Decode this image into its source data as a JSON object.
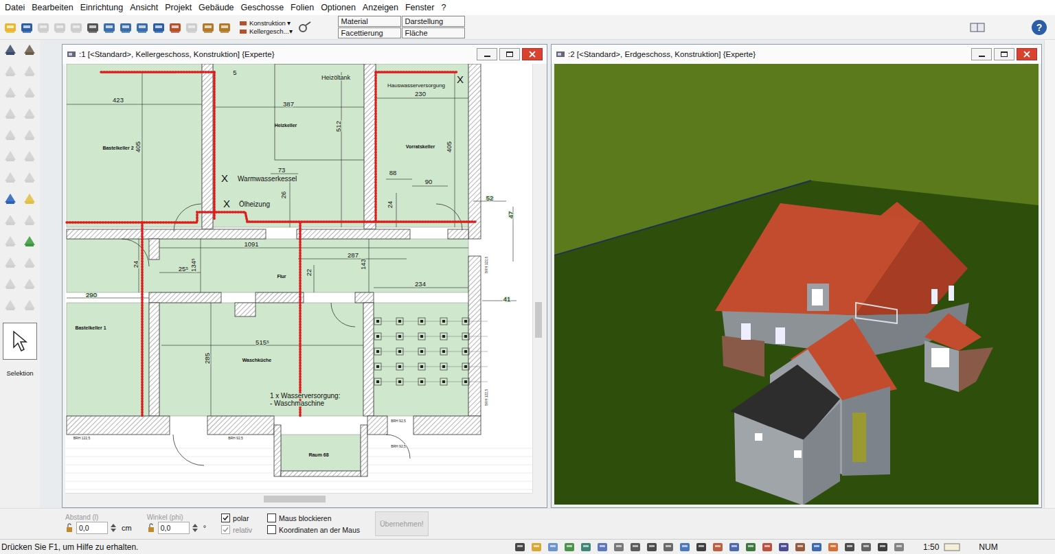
{
  "menu": [
    "Datei",
    "Bearbeiten",
    "Einrichtung",
    "Ansicht",
    "Projekt",
    "Gebäude",
    "Geschosse",
    "Folien",
    "Optionen",
    "Anzeigen",
    "Fenster",
    "?"
  ],
  "toolbar": {
    "top_tools": [
      {
        "disabled": false
      },
      {
        "disabled": false
      },
      {
        "disabled": true
      },
      {
        "disabled": true
      },
      {
        "disabled": true
      },
      {
        "disabled": false
      },
      {
        "disabled": false
      },
      {
        "disabled": false
      },
      {
        "disabled": false
      },
      {
        "disabled": false
      },
      {
        "disabled": false
      },
      {
        "disabled": true
      },
      {
        "disabled": false
      },
      {
        "disabled": false
      }
    ],
    "dropdowns": [
      "Konstruktion ▾",
      "Kellergesch...▾"
    ],
    "view_buttons": [
      "Material",
      "Darstellung",
      "Facettierung",
      "Fläche"
    ],
    "help": "?"
  },
  "left_tools": {
    "items": [
      {
        "disabled": false
      },
      {
        "disabled": false
      },
      {
        "disabled": true
      },
      {
        "disabled": true
      },
      {
        "disabled": true
      },
      {
        "disabled": true
      },
      {
        "disabled": true
      },
      {
        "disabled": true
      },
      {
        "disabled": true
      },
      {
        "disabled": true
      },
      {
        "disabled": true
      },
      {
        "disabled": true
      },
      {
        "disabled": true
      },
      {
        "disabled": true
      },
      {
        "disabled": false
      },
      {
        "disabled": false
      },
      {
        "disabled": true
      },
      {
        "disabled": true
      },
      {
        "disabled": true
      },
      {
        "disabled": false
      },
      {
        "disabled": true
      },
      {
        "disabled": true
      },
      {
        "disabled": true
      },
      {
        "disabled": true
      },
      {
        "disabled": true
      },
      {
        "disabled": true
      }
    ],
    "selection_label": "Selektion"
  },
  "windows": [
    {
      "title": ":1 [<Standard>, Kellergeschoss, Konstruktion] {Experte}",
      "kind": "plan"
    },
    {
      "title": ":2 [<Standard>, Erdgeschoss, Konstruktion] {Experte}",
      "kind": "view3d"
    }
  ],
  "plan": {
    "rooms": [
      "Bastelkeller 2",
      "Heizkeller",
      "Vorratskeller",
      "Flur",
      "Bastelkeller 1",
      "Waschküche",
      "Raum 68"
    ],
    "notes": [
      "Heizöltank",
      "Hauswasserversorgung",
      "Warmwasserkessel",
      "Ölheizung",
      "1 x Wasserversorgung:",
      "- Waschmaschine"
    ],
    "marks": [
      "X",
      "X",
      "X"
    ],
    "dimensions": [
      "5",
      "423",
      "387",
      "512",
      "230",
      "405",
      "405",
      "73",
      "26",
      "88",
      "90",
      "52",
      "47",
      "24",
      "1091",
      "287",
      "143",
      "22",
      "234",
      "41",
      "290",
      "25⁵",
      "24",
      "134⁵",
      "515⁵",
      "285"
    ],
    "wall_labels": [
      "BRH 122,5",
      "BRH 122,5",
      "BRH 122,5",
      "BRH 92,5",
      "BRH 92,5",
      "BRH 92,5"
    ]
  },
  "input_bar": {
    "distance": {
      "label": "Abstand (l)",
      "value": "0,0",
      "unit": "cm"
    },
    "angle": {
      "label": "Winkel (phi)",
      "value": "0,0",
      "unit": "°"
    },
    "checks": [
      {
        "label": "polar",
        "checked": true,
        "disabled": false
      },
      {
        "label": "relativ",
        "checked": true,
        "disabled": true
      },
      {
        "label": "Maus blockieren",
        "checked": false,
        "disabled": false
      },
      {
        "label": "Koordinaten an der Maus",
        "checked": false,
        "disabled": false
      }
    ],
    "apply": {
      "label": "Übernehmen!",
      "disabled": true
    }
  },
  "status_bar": {
    "hint": "Drücken Sie F1, um Hilfe zu erhalten.",
    "scale": "1:50",
    "num": "NUM"
  }
}
